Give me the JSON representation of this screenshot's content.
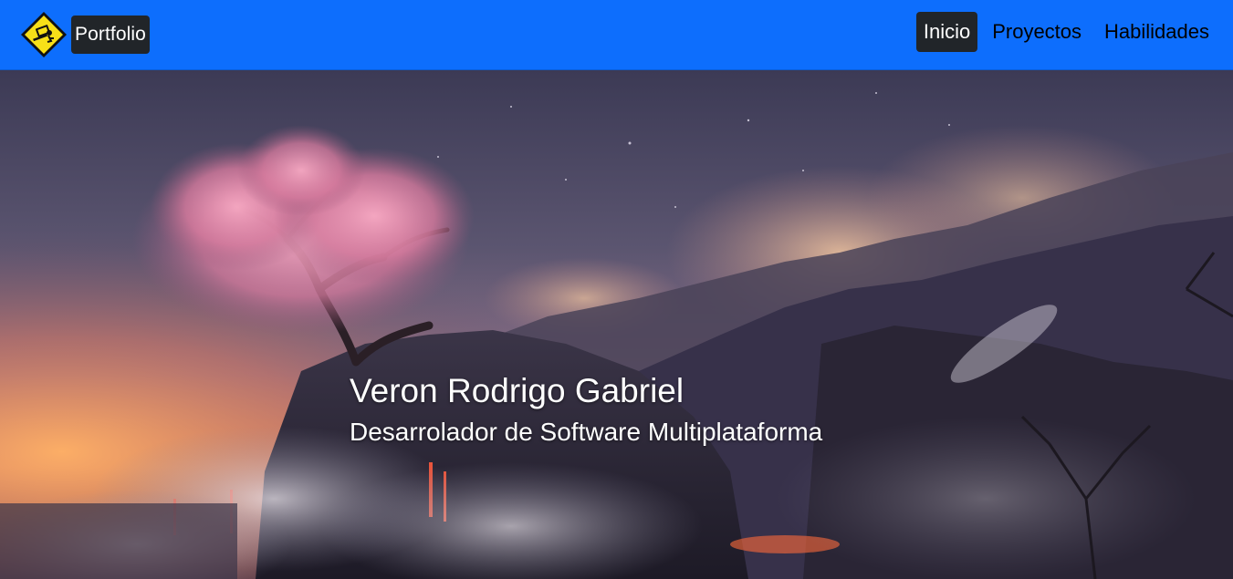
{
  "navbar": {
    "brand_label": "Portfolio",
    "brand_icon": "developer-laptop-diamond-icon",
    "background_color": "#0d6efd",
    "links": [
      {
        "label": "Inicio",
        "active": true
      },
      {
        "label": "Proyectos",
        "active": false
      },
      {
        "label": "Habilidades",
        "active": false
      }
    ]
  },
  "hero": {
    "name": "Veron Rodrigo Gabriel",
    "role": "Desarrolador de Software Multiplataforma",
    "background_image": "cherry-blossom-tree-volcanic-landscape"
  }
}
